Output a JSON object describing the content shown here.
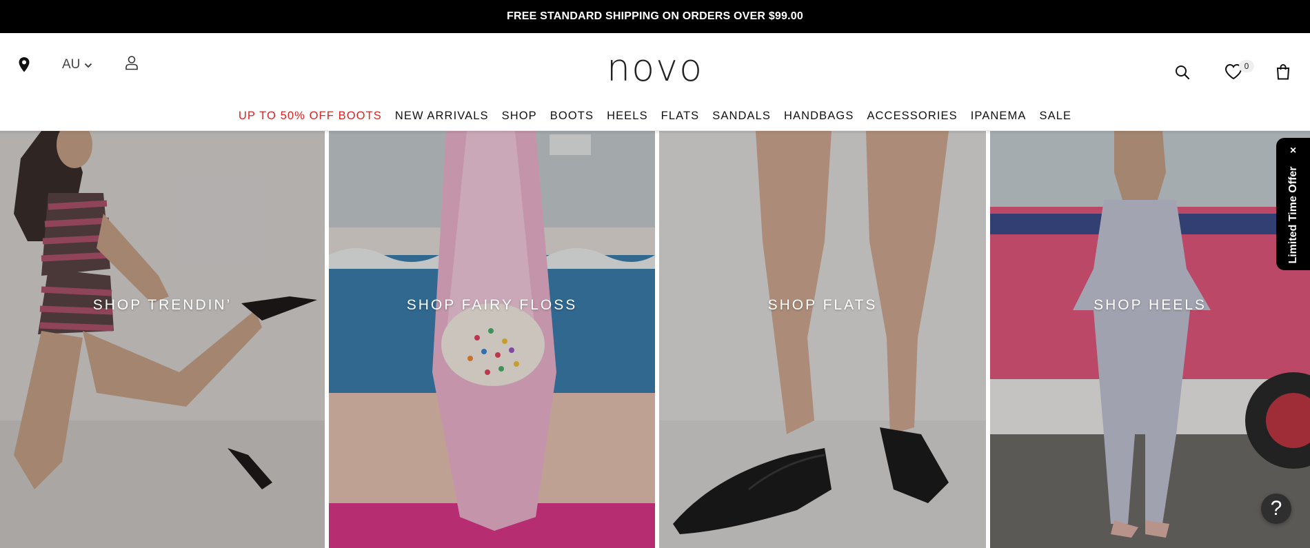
{
  "promo": {
    "text": "FREE STANDARD SHIPPING ON ORDERS OVER $99.00"
  },
  "header": {
    "country": "AU",
    "logo": "novo",
    "wishlist_count": "0",
    "icons": {
      "store": "map-pin-icon",
      "account": "user-icon",
      "search": "search-icon",
      "wishlist": "heart-icon",
      "cart": "shopping-bag-icon"
    }
  },
  "nav": [
    {
      "label": "UP TO 50% OFF BOOTS",
      "color": "#e02020"
    },
    {
      "label": "NEW ARRIVALS"
    },
    {
      "label": "SHOP"
    },
    {
      "label": "BOOTS"
    },
    {
      "label": "HEELS"
    },
    {
      "label": "FLATS"
    },
    {
      "label": "SANDALS"
    },
    {
      "label": "HANDBAGS"
    },
    {
      "label": "ACCESSORIES"
    },
    {
      "label": "IPANEMA"
    },
    {
      "label": "SALE"
    }
  ],
  "tiles": [
    {
      "label": "SHOP TRENDIN’"
    },
    {
      "label": "SHOP FAIRY FLOSS"
    },
    {
      "label": "SHOP FLATS"
    },
    {
      "label": "SHOP HEELS"
    }
  ],
  "offer": {
    "text": "Limited Time Offer",
    "close": "×"
  },
  "help": {
    "label": "?"
  }
}
